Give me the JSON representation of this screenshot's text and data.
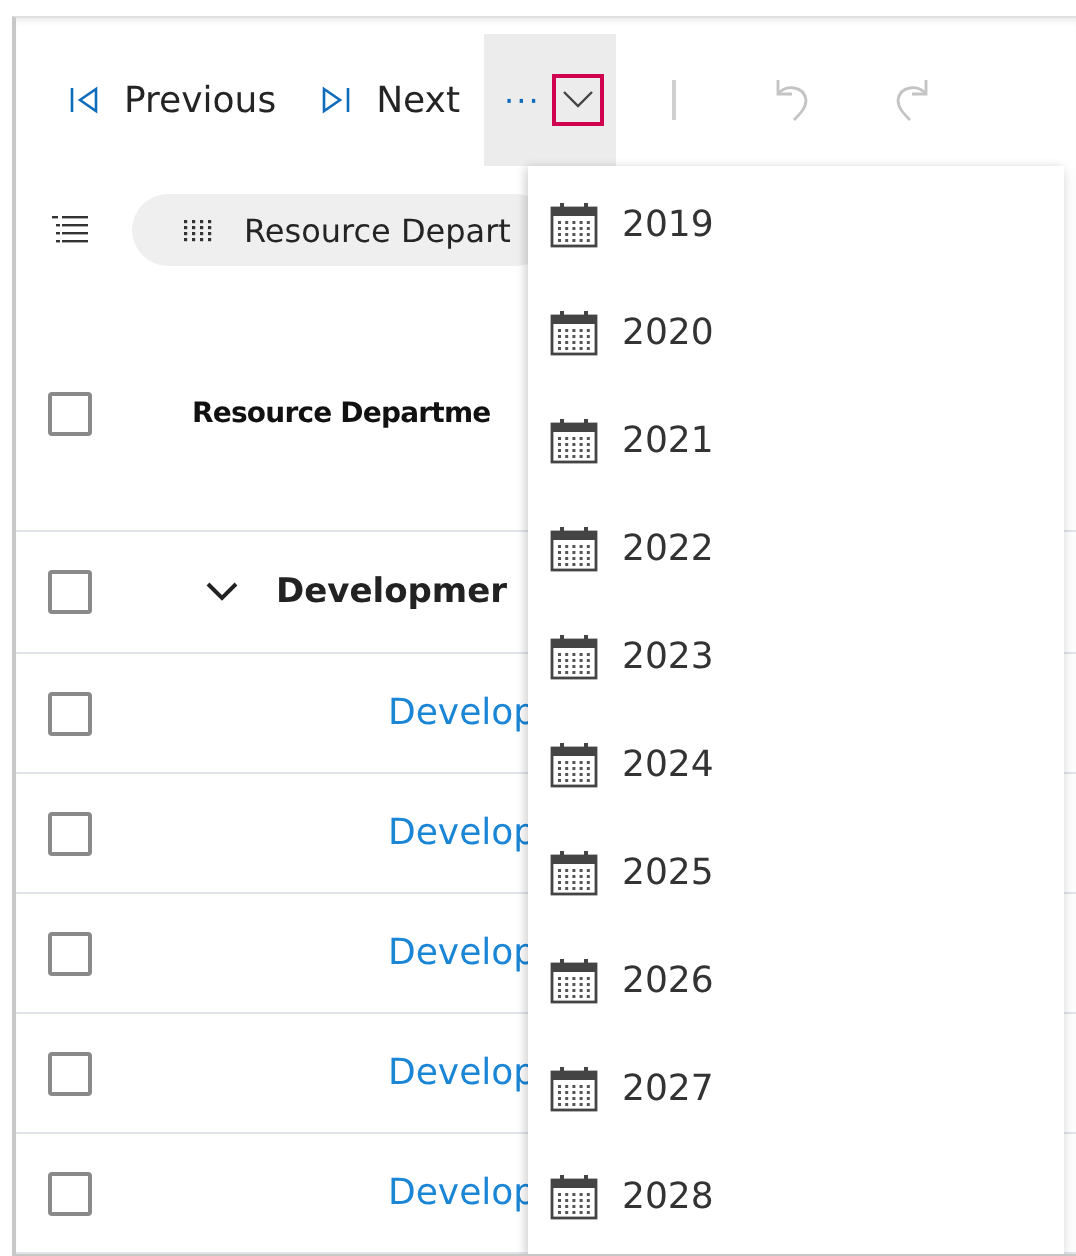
{
  "toolbar": {
    "previous": "Previous",
    "next": "Next",
    "more": "···",
    "undo_disabled": true,
    "redo_disabled": true,
    "dropdown_focused": true
  },
  "group_chip": {
    "label": "Resource Depart"
  },
  "table": {
    "header": {
      "checked": false,
      "column_1": "Resource Departme"
    },
    "group": {
      "checked": false,
      "expanded": true,
      "label": "Developmer"
    },
    "rows": [
      {
        "checked": false,
        "column_1": "Develop"
      },
      {
        "checked": false,
        "column_1": "Develop"
      },
      {
        "checked": false,
        "column_1": "Develop"
      },
      {
        "checked": false,
        "column_1": "Develop"
      },
      {
        "checked": false,
        "column_1": "Develop"
      }
    ]
  },
  "dropdown_menu": {
    "items": [
      {
        "label": "2019"
      },
      {
        "label": "2020"
      },
      {
        "label": "2021"
      },
      {
        "label": "2022"
      },
      {
        "label": "2023"
      },
      {
        "label": "2024"
      },
      {
        "label": "2025"
      },
      {
        "label": "2026"
      },
      {
        "label": "2027"
      },
      {
        "label": "2028"
      }
    ]
  }
}
